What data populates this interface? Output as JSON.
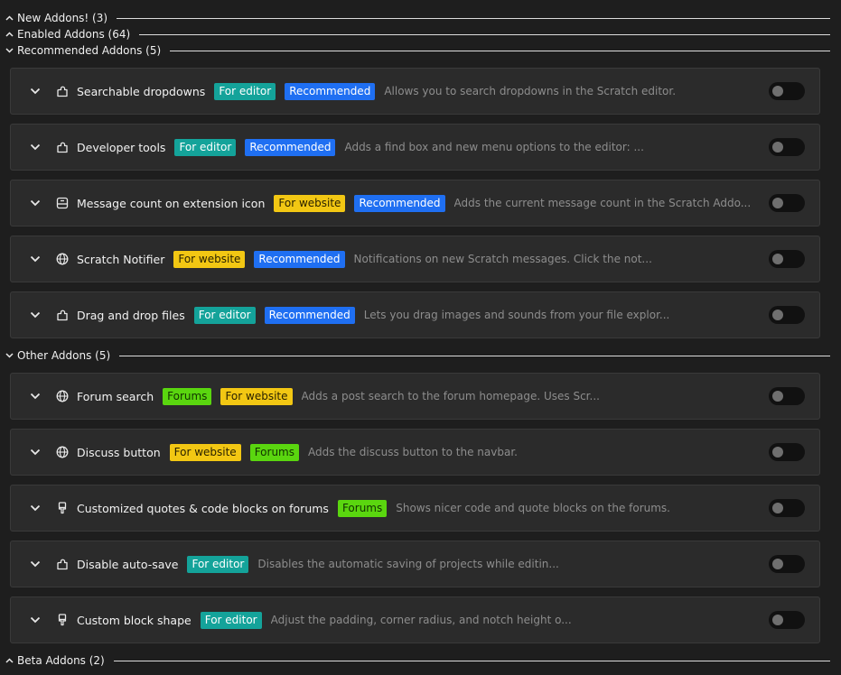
{
  "categories": {
    "new": {
      "title": "New Addons! (3)"
    },
    "enabled": {
      "title": "Enabled Addons (64)"
    },
    "recommended": {
      "title": "Recommended Addons (5)"
    },
    "other": {
      "title": "Other Addons (5)"
    },
    "beta": {
      "title": "Beta Addons (2)"
    }
  },
  "recommended_addons": [
    {
      "name": "Searchable dropdowns",
      "icon": "puzzle-icon",
      "tags": [
        "For editor",
        "Recommended"
      ],
      "description": "Allows you to search dropdowns in the Scratch editor.",
      "enabled": false
    },
    {
      "name": "Developer tools",
      "icon": "puzzle-icon",
      "tags": [
        "For editor",
        "Recommended"
      ],
      "description": "Adds a find box and new menu options to the editor: ...",
      "enabled": false
    },
    {
      "name": "Message count on extension icon",
      "icon": "popup-icon",
      "tags": [
        "For website",
        "Recommended"
      ],
      "description": "Adds the current message count in the Scratch Addo...",
      "enabled": false
    },
    {
      "name": "Scratch Notifier",
      "icon": "globe-icon",
      "tags": [
        "For website",
        "Recommended"
      ],
      "description": "Notifications on new Scratch messages. Click the not...",
      "enabled": false
    },
    {
      "name": "Drag and drop files",
      "icon": "puzzle-icon",
      "tags": [
        "For editor",
        "Recommended"
      ],
      "description": "Lets you drag images and sounds from your file explor...",
      "enabled": false
    }
  ],
  "other_addons": [
    {
      "name": "Forum search",
      "icon": "globe-icon",
      "tags": [
        "Forums",
        "For website"
      ],
      "description": "Adds a post search to the forum homepage. Uses Scr...",
      "enabled": false
    },
    {
      "name": "Discuss button",
      "icon": "globe-icon",
      "tags": [
        "For website",
        "Forums"
      ],
      "description": "Adds the discuss button to the navbar.",
      "enabled": false
    },
    {
      "name": "Customized quotes & code blocks on forums",
      "icon": "brush-icon",
      "tags": [
        "Forums"
      ],
      "description": "Shows nicer code and quote blocks on the forums.",
      "enabled": false
    },
    {
      "name": "Disable auto-save",
      "icon": "puzzle-icon",
      "tags": [
        "For editor"
      ],
      "description": "Disables the automatic saving of projects while editin...",
      "enabled": false
    },
    {
      "name": "Custom block shape",
      "icon": "brush-icon",
      "tags": [
        "For editor"
      ],
      "description": "Adjust the padding, corner radius, and notch height o...",
      "enabled": false
    }
  ],
  "colors": {
    "for_editor": "#14a39a",
    "for_website": "#f2c713",
    "recommended": "#1f6ff2",
    "forums": "#5ad60f"
  }
}
